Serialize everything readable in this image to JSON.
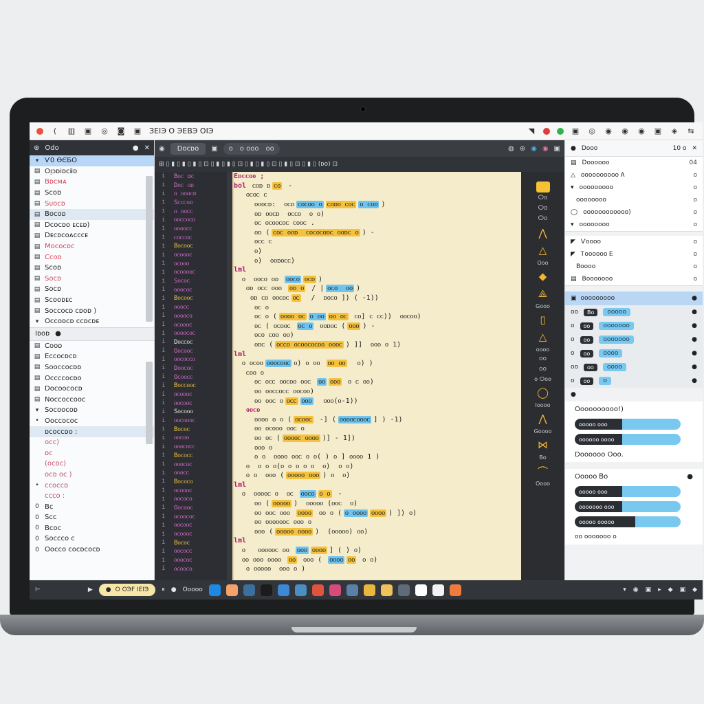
{
  "titlebar": {
    "text": "ЗЕIЭ О ЭЕВЭ ОIЭ",
    "icons": [
      "record-dot",
      "paren-icon",
      "grid-icon",
      "copy-icon",
      "target-icon",
      "camera-icon",
      "square-icon"
    ],
    "status_colors": [
      "#e8543a",
      "#e23a3a",
      "#2fb34a",
      "#555555"
    ]
  },
  "left_panel": {
    "header": "Odo",
    "items": [
      {
        "label": "Ѵ0 ӨЄБО",
        "ic": "▾",
        "sel": true
      },
      {
        "label": "Oᴉᴐᴅiᴅᴄⅱᴅ",
        "ic": "▤"
      },
      {
        "label": "Bᴅᴄᴍᴀ",
        "ic": "▤",
        "red": true
      },
      {
        "label": "Sᴄᴏᴅ",
        "ic": "▤"
      },
      {
        "label": "Sᴜᴏᴄᴅ",
        "ic": "▤",
        "red": true
      },
      {
        "label": "Bᴏᴄᴏᴅ",
        "ic": "▤",
        "hl": true
      },
      {
        "label": "Dᴄᴏᴄᴅᴏ ᴇᴄᴇᴅ)",
        "ic": "▤"
      },
      {
        "label": "Dᴇᴄᴅᴄᴏᴀᴄᴄᴄᴇ",
        "ic": "▤"
      },
      {
        "label": "Mᴏᴄᴏᴄᴅᴄ",
        "ic": "▤",
        "red": true
      },
      {
        "label": "Cᴄᴏᴅ",
        "ic": "▤",
        "red": true
      },
      {
        "label": "Sᴄᴏᴅ",
        "ic": "▤"
      },
      {
        "label": "Sᴏᴄᴅ",
        "ic": "▤",
        "red": true
      },
      {
        "label": "Sᴏᴄᴅ",
        "ic": "▤"
      },
      {
        "label": "Sᴄᴏᴏᴅᴇᴄ",
        "ic": "▤"
      },
      {
        "label": "Sᴏᴄᴄᴏᴄᴅ ᴄᴅᴏᴅ )",
        "ic": "▤"
      },
      {
        "label": "Oᴄᴄᴏᴅᴄᴅ ᴄᴄᴅᴄᴅᴇ",
        "ic": "▾"
      }
    ],
    "section": {
      "label": "Iᴅᴏᴅ",
      "mark": "●"
    },
    "items2": [
      {
        "label": "Cᴏᴏᴅ",
        "ic": "▤"
      },
      {
        "label": "Eᴄᴄᴏᴄᴅᴄᴅ",
        "ic": "▤"
      },
      {
        "label": "Sᴏᴏᴄᴄᴏᴄᴅᴅ",
        "ic": "▤"
      },
      {
        "label": "Oᴄᴄᴄᴄᴏᴄᴅᴏ",
        "ic": "▤"
      },
      {
        "label": "Dᴏᴄᴏᴏᴄᴏᴄᴅ",
        "ic": "▤"
      },
      {
        "label": "Nᴏᴄᴄᴏᴄᴄᴏᴏᴄ",
        "ic": "▤"
      },
      {
        "label": "Sᴏᴄᴏᴏᴄᴏᴅ",
        "ic": "▾"
      },
      {
        "label": "Oᴏᴄᴄᴏᴄᴏᴄ",
        "ic": "•"
      },
      {
        "label": "ᴅᴄᴏᴄᴄᴅᴏ :",
        "ic": "",
        "hl": true
      },
      {
        "label": "oᴄᴄ)",
        "ic": "",
        "pink": true
      },
      {
        "label": "ᴅᴄ",
        "ic": "",
        "red": true
      },
      {
        "label": "(ᴏᴄᴅᴄ)",
        "ic": "",
        "pink": true
      },
      {
        "label": "oᴄᴅ ᴏᴄ )",
        "ic": "",
        "pink": true
      },
      {
        "label": "ᴄᴄᴏᴄᴄᴅ",
        "ic": "•",
        "pink": true
      },
      {
        "label": "ᴄᴄᴄᴏ :",
        "ic": "",
        "pink": true
      },
      {
        "label": "Bᴄ",
        "ic": "0"
      },
      {
        "label": "Sᴄᴄ",
        "ic": "0"
      },
      {
        "label": "Bᴄᴏᴄ",
        "ic": "0"
      },
      {
        "label": "Sᴏᴄᴄᴄᴏ ᴄ",
        "ic": "0"
      },
      {
        "label": "Oᴏᴄᴄᴏ ᴄᴏᴄᴅᴄᴏᴄᴅ",
        "ic": "0"
      }
    ]
  },
  "editor": {
    "tabs": [
      "Dᴏᴄᴅᴏ",
      "ᴏ ᴏ ᴏ ᴏ"
    ],
    "tab_pill": [
      "ᴏ",
      "ᴏ ᴏᴏᴏ",
      "ᴏᴏ"
    ],
    "toolbar": "⊞ ▯ ▮ ▯ ▮ ▯ ▮ ▯ ⊡ ▯ ▮ ▯ ▮ ▯ ⊡ ▯ ▮ ▯ ▮ ▯ ⊡ ▯ ▮ ▯ ⊡ ▯ ▮ ▯ (ᴅᴏ) ⊡",
    "gutter": [
      [
        "i",
        "Bᴏᴄ ɑᴄ",
        "p"
      ],
      [
        "i",
        "Dᴏᴄ ᴏᴅ",
        "p"
      ],
      [
        "i",
        "ᴏ ᴏᴏᴏᴄᴅ",
        "p"
      ],
      [
        "i",
        "Sᴄᴄᴄᴏᴅ",
        "p"
      ],
      [
        "i",
        "ᴏ ᴏᴏᴄᴄ",
        "p"
      ],
      [
        "i",
        "ᴏᴏᴄᴄᴏᴄᴅ",
        "p"
      ],
      [
        "i",
        "ᴏᴏᴏᴏᴄᴄ",
        "p"
      ],
      [
        "i",
        "ᴄᴏᴄᴄᴏᴄ",
        "p"
      ],
      [
        "i",
        "Bᴏᴄᴏᴏᴄ",
        "y"
      ],
      [
        "i",
        "ᴏᴄᴏᴏᴏᴄ",
        "p"
      ],
      [
        "i",
        "ᴏᴄᴏᴏᴏ",
        "p"
      ],
      [
        "i",
        "ᴏᴄᴏᴏᴏᴏᴄ",
        "p"
      ],
      [
        "i",
        "Sᴏᴄᴏᴄ",
        "p"
      ],
      [
        "i",
        "ᴏᴏᴏᴄᴏᴄ",
        "p"
      ],
      [
        "i",
        "Bᴏᴄᴏᴏᴄ",
        "y"
      ],
      [
        "i",
        "ᴏᴏᴏᴄᴄ",
        "p"
      ],
      [
        "i",
        "ᴏᴏᴏᴏᴄᴏ",
        "p"
      ],
      [
        "i",
        "ᴏᴄᴏᴏᴏᴄ",
        "p"
      ],
      [
        "i",
        "ᴏᴏᴏᴏᴄᴏᴄ",
        "p"
      ],
      [
        "i",
        "Dᴏᴄᴄᴏᴄ",
        "w"
      ],
      [
        "i",
        "Oᴏᴄᴏᴏᴄ",
        "p"
      ],
      [
        "i",
        "ᴏᴏᴄᴏᴄᴄᴏ",
        "p"
      ],
      [
        "i",
        "Dᴏᴏᴄᴏᴄ",
        "p"
      ],
      [
        "i",
        "Oᴄᴏᴏᴄᴄ",
        "p"
      ],
      [
        "i",
        "Bᴏᴄᴄᴏᴏᴄ",
        "y"
      ],
      [
        "i",
        "ᴏᴄᴏᴏᴏᴄ",
        "p"
      ],
      [
        "i",
        "ᴏᴏᴄᴏᴏᴄ",
        "p"
      ],
      [
        "i",
        "Sᴏᴄᴏᴏᴏ",
        "w"
      ],
      [
        "i",
        "ᴏᴏᴄᴏᴏᴏᴄ",
        "p"
      ],
      [
        "i",
        "Bᴏᴄᴏᴄ",
        "y"
      ],
      [
        "i",
        "ᴏᴏᴄᴏᴏ",
        "p"
      ],
      [
        "i",
        "ᴏᴏᴏᴄᴏᴄᴄ",
        "p"
      ],
      [
        "i",
        "Bᴏᴄᴏᴄᴄ",
        "y"
      ],
      [
        "i",
        "ᴏᴏᴏᴄᴏᴄ",
        "p"
      ],
      [
        "i",
        "ᴏᴏᴏᴄᴄ",
        "p"
      ],
      [
        "i",
        "Bᴏᴄᴏᴄᴏ",
        "y"
      ],
      [
        "i",
        "ᴏᴄᴏᴏᴏᴄ",
        "p"
      ],
      [
        "i",
        "ᴏᴏᴄᴏᴄᴏ",
        "p"
      ],
      [
        "i",
        "Oᴏᴄᴏᴏᴄ",
        "p"
      ],
      [
        "i",
        "ᴏᴄᴏᴏᴄᴏᴄ",
        "p"
      ],
      [
        "i",
        "ᴏᴏᴄᴏᴏᴄ",
        "p"
      ],
      [
        "i",
        "ᴏᴄᴏᴏᴏᴄ",
        "p"
      ],
      [
        "i",
        "Bᴏᴄᴏᴄ",
        "y"
      ],
      [
        "i",
        "ᴏᴏᴄᴏᴄᴄ",
        "p"
      ],
      [
        "i",
        "ᴏᴏᴏᴄᴏᴄ",
        "p"
      ],
      [
        "i",
        "ᴏᴄᴏᴏᴄᴏ",
        "p"
      ]
    ],
    "code": [
      [
        [
          "kw",
          "Eᴅᴄᴄᴏᴏ ;"
        ]
      ],
      [
        [
          "kw",
          "bol"
        ],
        [
          "t",
          " ᴄᴏᴅ ᴅ"
        ],
        [
          "y",
          "ᴄᴏ"
        ],
        [
          "t",
          " -"
        ]
      ],
      [
        [
          "t",
          "   ᴏᴄᴏᴄ ᴄ"
        ]
      ],
      [
        [
          "t",
          "     ᴏᴏᴏᴄᴅ:  ᴏᴄᴅ"
        ],
        [
          "b",
          "ᴄᴏᴄᴏᴏ ᴏ"
        ],
        [
          "y",
          "ᴄᴏᴅᴏ ᴄᴏᴄ"
        ],
        [
          "b",
          "ᴏ ᴄᴏᴅ"
        ],
        [
          "t",
          ")"
        ]
      ],
      [
        [
          "t",
          "     ᴏᴅ ᴏᴏᴄᴅ  ᴏᴄᴄᴏ  ᴏ ᴏ)"
        ]
      ],
      [
        [
          "t",
          "     ᴏᴄ ᴏᴄᴏᴏᴄᴏᴄ ᴄᴏᴏᴄ ."
        ]
      ],
      [
        [
          "t",
          "     ᴏᴅ ("
        ],
        [
          "y",
          "ᴄᴏᴄ ᴏᴏᴅ  ᴄᴏᴄᴏᴄᴏᴅᴄ ᴏᴏᴅᴄ ᴏ"
        ],
        [
          "t",
          ") -"
        ]
      ],
      [
        [
          "t",
          "     ᴏᴄᴄ ᴄ"
        ]
      ],
      [
        [
          "t",
          "     ᴏ)"
        ]
      ],
      [
        [
          "t",
          "     ᴏ)  ᴏᴏᴅᴏᴄᴄ)"
        ]
      ],
      [
        [
          "kw",
          "lml"
        ]
      ],
      [
        [
          "t",
          "  ᴏ  ᴏᴏᴄᴏ ᴏᴅ "
        ],
        [
          "b",
          "ᴏᴏᴄᴏ"
        ],
        [
          "y",
          "ᴏᴄᴅ"
        ],
        [
          "t",
          ")"
        ]
      ],
      [
        [
          "t",
          "   ᴏᴅ ᴏᴄᴄ ᴏᴏᴏ "
        ],
        [
          "y",
          "ᴏᴅ ᴏ"
        ],
        [
          "t",
          " / |"
        ],
        [
          "b",
          "ᴏᴄᴏ  ᴏᴏ"
        ],
        [
          "t",
          ")"
        ]
      ],
      [
        [
          "t",
          "    ᴏᴅ ᴄᴏ ᴏᴏᴄᴏᴄ"
        ],
        [
          "y",
          "ᴏᴄ"
        ],
        [
          "t",
          "  /  ᴅᴏᴄᴏ ]) ( -1))"
        ]
      ],
      [
        [
          "t",
          "     ᴏᴄ ᴏ"
        ]
      ],
      [
        [
          "t",
          "     ᴏᴄ ᴏ ("
        ],
        [
          "y",
          "ᴏᴏᴏᴏ ᴏᴄ"
        ],
        [
          "b",
          "ᴏ ᴏᴏ"
        ],
        [
          "y",
          "ᴏᴏ ᴏᴄ"
        ],
        [
          "t",
          " ᴄᴏ] ᴄ ᴄᴄ))  ᴏᴏᴄᴏᴏ)"
        ]
      ],
      [
        [
          "t",
          "     ᴏᴄ ( ᴏᴄᴏᴏᴄ "
        ],
        [
          "b",
          "ᴏᴄ ᴏ"
        ],
        [
          "t",
          " ᴏᴏᴅᴏᴄ ("
        ],
        [
          "y",
          "ᴏᴏᴏ"
        ],
        [
          "t",
          ") -"
        ]
      ],
      [
        [
          "t",
          "     ᴏᴄᴏ ᴄᴏᴏ ᴏᴏ)"
        ]
      ],
      [
        [
          "t",
          "     ᴏᴅᴄ ("
        ],
        [
          "y",
          "ᴏᴄᴄᴏ ᴏᴄᴏᴏᴄᴏᴄᴏᴏ ᴏᴏᴏᴄ"
        ],
        [
          "t",
          ") ]]  ᴏᴏᴏ ᴏ 1)"
        ]
      ],
      [
        [
          "kw",
          "lml"
        ]
      ],
      [
        [
          "t",
          "  ᴏ ᴏᴄᴏᴏ"
        ],
        [
          "b",
          "ᴏᴏᴏᴄᴏᴏᴄ"
        ],
        [
          "t",
          "ᴏ) ᴏ ᴏᴏ "
        ],
        [
          "y",
          "ᴏᴏ ᴏᴏ"
        ],
        [
          "t",
          "  ᴏ) )"
        ]
      ],
      [
        [
          "t",
          "   ᴄᴏᴏ ᴏ"
        ]
      ],
      [
        [
          "t",
          "     ᴏᴄ ᴏᴄᴄ ᴏᴏᴄᴏᴏ ᴏᴏᴄ "
        ],
        [
          "b",
          "ᴏᴏ"
        ],
        [
          "y",
          "ᴏᴏᴏ"
        ],
        [
          "t",
          " ᴏ ᴄ ᴏᴏ)"
        ]
      ],
      [
        [
          "t",
          "     ᴏᴏ ᴏᴏᴄᴄᴏᴄᴄ ᴏᴏᴄᴏᴏ)"
        ]
      ],
      [
        [
          "t",
          "     ᴏᴏ ᴏᴏᴄ ᴏ"
        ],
        [
          "y",
          "ᴏᴄᴄ"
        ],
        [
          "b",
          "ᴏᴏᴏ"
        ],
        [
          "t",
          "  ᴏᴏᴏ(ᴏ-1))"
        ]
      ],
      [
        [
          "kw",
          "   ᴏᴏᴄᴏ"
        ]
      ],
      [
        [
          "t",
          "     ᴏᴏᴏᴏ ᴏ ᴏ ("
        ],
        [
          "y",
          "ᴏᴄᴏᴏᴄ"
        ],
        [
          "t",
          " -] ("
        ],
        [
          "b",
          "ᴏᴏᴏᴏᴄᴏᴏᴏᴄ"
        ],
        [
          "t",
          "] ) -1)"
        ]
      ],
      [
        [
          "t",
          "     ᴏᴏ ᴏᴄᴏᴏᴏ ᴏᴏᴄ ᴏ"
        ]
      ],
      [
        [
          "t",
          "     ᴏᴏ ᴏᴄ ("
        ],
        [
          "y",
          "ᴏᴏᴏᴏᴄ ᴏᴏᴏᴏ"
        ],
        [
          "t",
          ")] - 1])"
        ]
      ],
      [
        [
          "t",
          "     ᴏᴏᴏ ᴏ"
        ]
      ],
      [
        [
          "t",
          "     ᴏ ᴏ  ᴏᴏᴏᴏ ᴏᴏᴄ ᴏ ᴏ( ) ᴏ ] ᴏᴏᴏᴏ 1 )"
        ]
      ],
      [
        [
          "t",
          "   ᴏ  ᴏ ᴏ ᴏ(ᴏ ᴏ ᴏ ᴏ ᴏ  ᴏ)  ᴏ ᴏ)"
        ]
      ],
      [
        [
          "t",
          "   ᴏ ᴏ  ᴏᴏᴏ ("
        ],
        [
          "y",
          "ᴏᴏᴏᴏᴏ ᴏᴏᴏ"
        ],
        [
          "t",
          ") ᴏ  ᴏ)"
        ]
      ],
      [
        [
          "kw",
          "lml"
        ]
      ],
      [
        [
          "t",
          "  ᴏ  ᴏᴏᴏᴏᴄ ᴏ  ᴏᴄ "
        ],
        [
          "b",
          "ᴏᴏᴄᴏ"
        ],
        [
          "y",
          "ᴏ ᴏ"
        ],
        [
          "t",
          " -"
        ]
      ],
      [
        [
          "t",
          "     ᴏᴏ ("
        ],
        [
          "y",
          "ᴏᴏᴏᴏᴏ"
        ],
        [
          "t",
          ")  ᴏᴏᴏᴏᴏ (ᴏᴏᴄ  ᴏ)"
        ]
      ],
      [
        [
          "t",
          "     ᴏᴏ ᴏᴏᴄ ᴏᴏᴏ "
        ],
        [
          "y",
          "ᴏᴏᴏᴏ"
        ],
        [
          "t",
          " ᴏᴏ ᴏ ("
        ],
        [
          "b",
          "ᴏ ᴏᴏᴏᴏ"
        ],
        [
          "y",
          "ᴏᴏᴏᴏ"
        ],
        [
          "t",
          ") ]) ᴏ)"
        ]
      ],
      [
        [
          "t",
          "     ᴏᴏ ᴏᴏᴏᴏᴏᴏᴄ ᴏᴏᴏ ᴏ"
        ]
      ],
      [
        [
          "t",
          "     ᴏᴏᴏ ("
        ],
        [
          "y",
          "ᴏᴏᴏᴏᴏ ᴏᴏᴏᴏ"
        ],
        [
          "t",
          ")  (ᴏᴏᴏᴏᴏ) ᴏᴏ)"
        ]
      ],
      [
        [
          "kw",
          "lml"
        ]
      ],
      [
        [
          "t",
          "  ᴏ   ᴏᴏᴏᴏᴏᴄ ᴏᴏ "
        ],
        [
          "b",
          "ᴏᴏᴏ"
        ],
        [
          "y",
          "ᴏᴏᴏᴏ"
        ],
        [
          "t",
          "] ( ) ᴏ)"
        ]
      ],
      [
        [
          "t",
          "  ᴏᴏ ᴏᴏᴏ ᴏᴏᴏᴏ "
        ],
        [
          "y",
          "ᴏᴏ"
        ],
        [
          "t",
          " ᴏᴏᴏ ( "
        ],
        [
          "b",
          "ᴏᴏᴏᴏ"
        ],
        [
          "y",
          "ᴏᴏ"
        ],
        [
          "t",
          " ᴏ ᴏ)"
        ]
      ],
      [
        [
          "t",
          "   ᴏ ᴏᴏᴏᴏᴏ  ᴏᴏᴏ ᴏ )"
        ]
      ]
    ]
  },
  "rail": [
    {
      "type": "sq"
    },
    {
      "type": "sm",
      "label": "Ѻᴏ"
    },
    {
      "type": "sm",
      "label": "Ѻᴏ"
    },
    {
      "type": "sm",
      "label": "Ѻᴏ"
    },
    {
      "type": "ic",
      "glyph": "⋀"
    },
    {
      "type": "ic",
      "glyph": "△"
    },
    {
      "type": "lbl",
      "label": "Oᴏᴏ"
    },
    {
      "type": "ic",
      "glyph": "◆"
    },
    {
      "type": "ic",
      "glyph": "⟁"
    },
    {
      "type": "lbl",
      "label": "Gᴏᴏᴏ"
    },
    {
      "type": "ic",
      "glyph": "▯"
    },
    {
      "type": "ic",
      "glyph": "△"
    },
    {
      "type": "lbl",
      "label": "ᴏᴏᴏᴏ"
    },
    {
      "type": "sm",
      "label": "ᴏᴏ"
    },
    {
      "type": "sm",
      "label": "ᴏᴏ"
    },
    {
      "type": "lbl",
      "label": "ᴏ Ѻᴏᴏ"
    },
    {
      "type": "ic",
      "glyph": "◯"
    },
    {
      "type": "lbl",
      "label": "Iᴏᴏᴏᴏ"
    },
    {
      "type": "ic",
      "glyph": "⋀"
    },
    {
      "type": "lbl",
      "label": "Gᴏᴏᴏᴏ"
    },
    {
      "type": "ic",
      "glyph": "⋈"
    },
    {
      "type": "lbl",
      "label": "Bᴏ"
    },
    {
      "type": "ic",
      "glyph": "⌒"
    },
    {
      "type": "lbl",
      "label": "Oᴏᴏᴏ"
    }
  ],
  "right_panel": {
    "header": "Dᴏᴏᴏ",
    "header_val": "10 ᴏ",
    "block1": [
      {
        "ic": "▤",
        "label": "Dᴏᴏᴏᴏᴏᴏ",
        "val": "04"
      },
      {
        "ic": "△",
        "label": "ᴏᴏᴏᴏᴏᴏᴏᴏᴏᴏ Ꭺ",
        "val": "ᴏ"
      },
      {
        "ic": "▾",
        "label": "ᴏᴏᴏᴏᴏᴏᴏᴏᴏ",
        "val": "ᴏ"
      },
      {
        "ic": "",
        "label": "ᴏᴏᴏᴏᴏᴏᴏᴏ",
        "val": "ᴏ"
      },
      {
        "ic": "◯",
        "label": "ᴏᴏᴏᴏᴏᴏᴏᴏᴏᴏᴏᴏ)",
        "val": "ᴏ"
      },
      {
        "ic": "▾",
        "label": "ᴏᴏᴏᴏᴏᴏᴏᴏ",
        "val": "ᴏ"
      }
    ],
    "block2": [
      {
        "ic": "◤",
        "label": "Ѵᴏᴏᴏᴏ",
        "val": "ᴏ"
      },
      {
        "ic": "◤",
        "label": "Ꭲᴏᴏᴏᴏᴏᴏ Ꭼ",
        "val": "ᴏ"
      },
      {
        "ic": "",
        "label": "Bᴏᴏᴏᴏ",
        "val": "ᴏ"
      },
      {
        "ic": "▤",
        "label": "Bᴏᴏᴏᴏᴏᴏᴏ",
        "val": "ᴏ"
      }
    ],
    "selected": "ᴏᴏᴏᴏᴏᴏᴏᴏᴏ",
    "rows": [
      {
        "a": "ᴏᴏ",
        "dk": "Bᴏ",
        "cy": "ᴏᴏᴏᴏᴏ"
      },
      {
        "a": "ᴏ",
        "dk": "ᴏᴏ",
        "cy": "ᴏᴏᴏᴏᴏᴏᴏ"
      },
      {
        "a": "ᴏ",
        "dk": "ᴏᴏ",
        "cy": "ᴏᴏᴏᴏᴏᴏᴏ"
      },
      {
        "a": "ᴏ",
        "dk": "ᴏᴏ",
        "cy": "ᴏᴏᴏᴏ"
      },
      {
        "a": "ᴏᴏ",
        "dk": "ᴏᴏ",
        "cy": "ᴏᴏᴏᴏ"
      },
      {
        "a": "ᴏ",
        "dk": "ᴏᴏ",
        "cy": "ᴏ"
      }
    ],
    "section1": "Oᴏᴏᴏᴏᴏᴏᴏᴏᴏ!)",
    "bars1": [
      {
        "label": "ᴏᴏᴏᴏᴏ ᴏᴏᴏ",
        "fill": 0.45
      },
      {
        "label": "ᴏᴏᴏᴏᴏᴏ ᴏᴏᴏᴏ",
        "fill": 0.45
      }
    ],
    "section1_footer": "Dᴏᴏᴏᴏᴏᴏ Oᴏᴏ.",
    "section2": "Oᴏᴏᴏᴏ Ᏼᴏ",
    "bars2": [
      {
        "label": "ᴏᴏᴏᴏᴏ ᴏᴏᴏ",
        "fill": 0.45
      },
      {
        "label": "ᴏᴏᴏᴏᴏᴏᴏ ᴏᴏᴏ",
        "fill": 0.45
      },
      {
        "label": "ᴏᴏᴏᴏᴏ ᴏᴏᴏᴏᴏ",
        "fill": 0.57
      }
    ],
    "footer": "ᴏᴏ ᴏᴏᴏᴏᴏᴏᴏ ᴏ"
  },
  "taskbar": {
    "pill": "O OЭF IЕIЭ",
    "label2": "Oᴏᴏᴏᴏ",
    "apps": [
      "#1e88e5",
      "#f4a26a",
      "#3b6f9e",
      "#1c1c1c",
      "#3b89d6",
      "#4a8fc4",
      "#e0533f",
      "#d54b79",
      "#5a7fa8",
      "#e7b83c",
      "#f0c25a",
      "#5f6b78",
      "#ffffff",
      "#f2f2f2",
      "#f07b3f"
    ],
    "tray": [
      "▾",
      "◉",
      "▣",
      "▸",
      "◆",
      "▣",
      "◆"
    ]
  }
}
